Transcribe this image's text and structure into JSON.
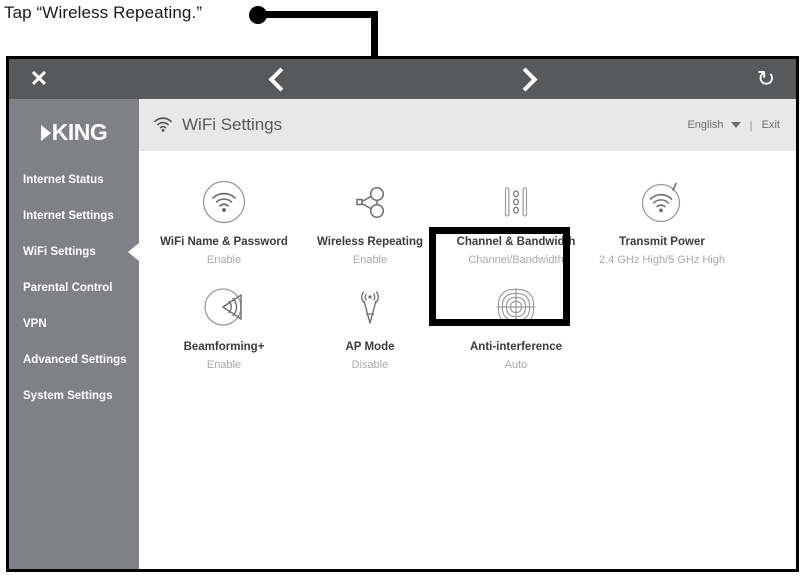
{
  "callout": {
    "caption": "Tap “Wireless Repeating.”",
    "dot": "callout-dot"
  },
  "browser_toolbar": {
    "close_label": "✕",
    "back_label": "<",
    "forward_label": ">",
    "reload_label": "↻"
  },
  "sidebar": {
    "brand": "KING",
    "items": [
      {
        "label": "Internet Status",
        "active": false
      },
      {
        "label": "Internet Settings",
        "active": false
      },
      {
        "label": "WiFi Settings",
        "active": true
      },
      {
        "label": "Parental Control",
        "active": false
      },
      {
        "label": "VPN",
        "active": false
      },
      {
        "label": "Advanced Settings",
        "active": false
      },
      {
        "label": "System Settings",
        "active": false
      }
    ]
  },
  "header": {
    "title": "WiFi Settings",
    "icon": "wifi-icon",
    "language": "English",
    "divider": "|",
    "exit": "Exit"
  },
  "tiles": [
    {
      "label": "WiFi Name & Password",
      "status": "Enable",
      "icon": "wifi-circle-icon",
      "highlighted": false
    },
    {
      "label": "Wireless Repeating",
      "status": "Enable",
      "icon": "share-network-icon",
      "highlighted": true
    },
    {
      "label": "Channel & Bandwidth",
      "status": "Channel/Bandwidth",
      "icon": "channel-bars-icon",
      "highlighted": false
    },
    {
      "label": "Transmit Power",
      "status": "2.4 GHz High/5 GHz High",
      "icon": "transmit-power-icon",
      "highlighted": false
    },
    {
      "label": "Beamforming+",
      "status": "Enable",
      "icon": "beamforming-icon",
      "highlighted": false
    },
    {
      "label": "AP Mode",
      "status": "Disable",
      "icon": "antenna-tower-icon",
      "highlighted": false
    },
    {
      "label": "Anti-interference",
      "status": "Auto",
      "icon": "anti-interference-icon",
      "highlighted": false
    }
  ],
  "colors": {
    "toolbar_gray": "#58595b",
    "sidebar_gray": "#808184",
    "header_gray": "#e8e8e8",
    "label_dark": "#3b3b3d",
    "status_gray": "#a7a9ac",
    "highlight_black": "#000000"
  }
}
